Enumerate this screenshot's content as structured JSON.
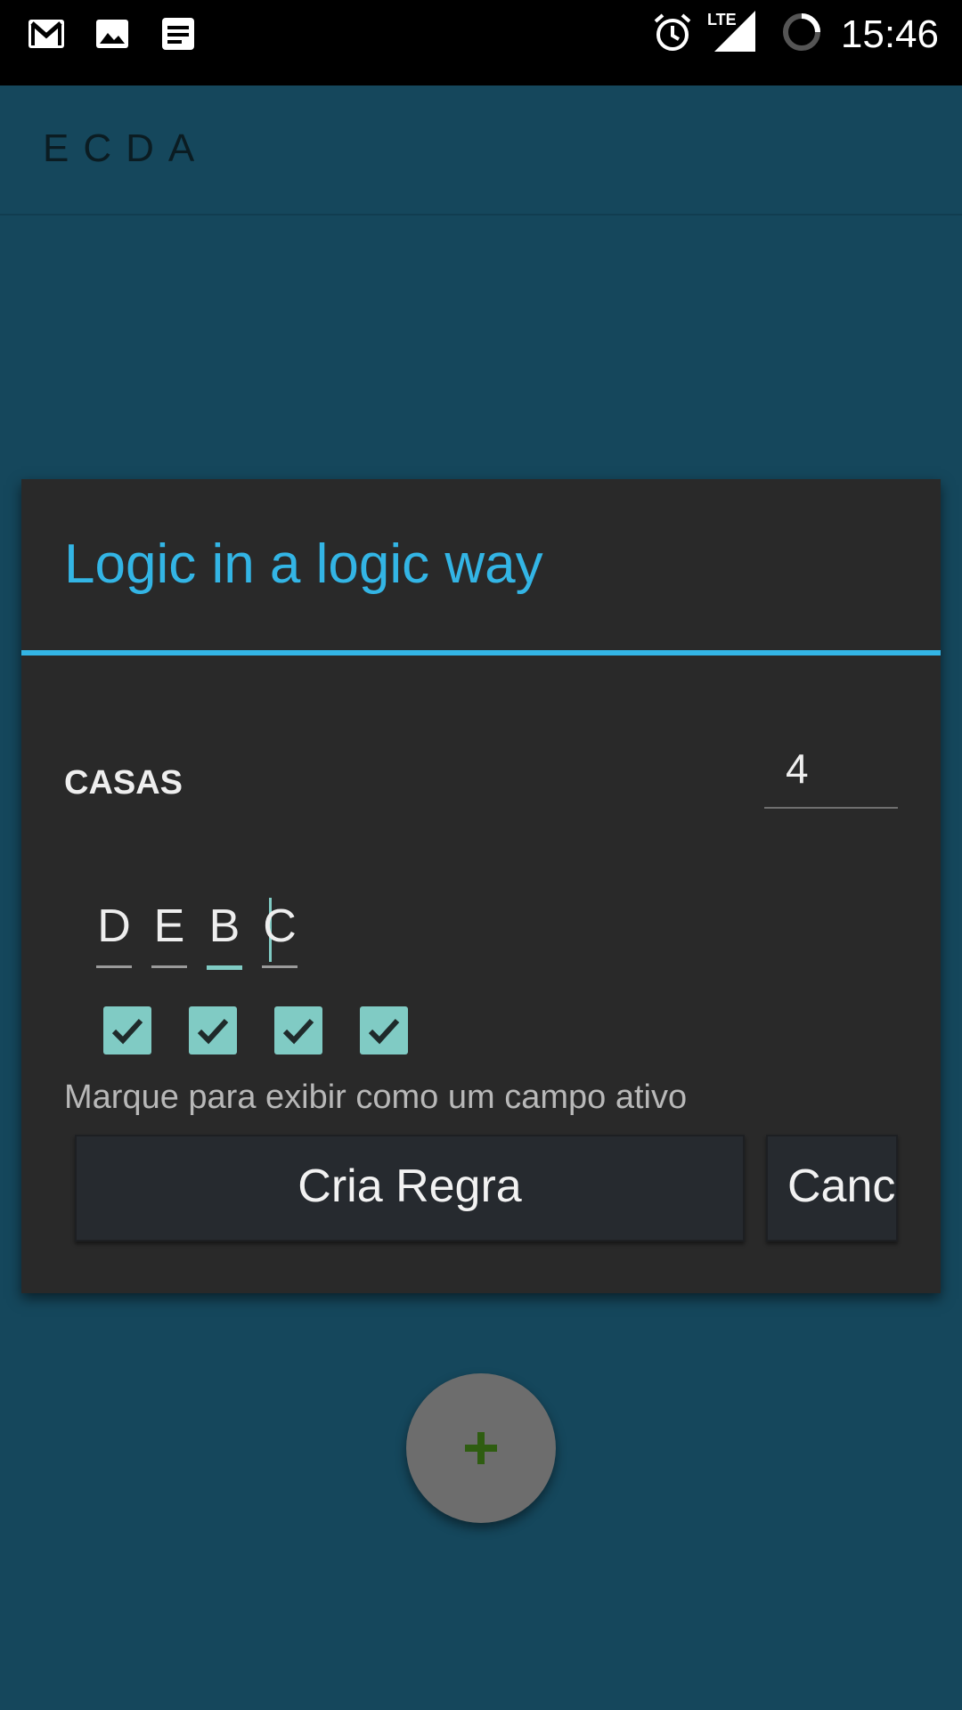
{
  "status_bar": {
    "icons": [
      "gmail-icon",
      "image-icon",
      "notes-icon",
      "alarm-icon",
      "lte-signal-icon",
      "loading-icon"
    ],
    "lte_label": "LTE",
    "time": "15:46"
  },
  "app_bar": {
    "title": "ECDA"
  },
  "dialog": {
    "title": "Logic in a logic way",
    "casas_label": "CASAS",
    "casas_value": "4",
    "letters": [
      "D",
      "E",
      "B",
      "C"
    ],
    "active_letter_index": 2,
    "checkboxes": [
      true,
      true,
      true,
      true
    ],
    "hint": "Marque para exibir como um campo ativo",
    "create_button": "Cria Regra",
    "cancel_button": "Cancel"
  },
  "fab": {
    "icon": "plus-icon"
  },
  "colors": {
    "background": "#15475c",
    "accent": "#33b5e5",
    "checkbox": "#80cbc4",
    "dialog": "#292929"
  }
}
